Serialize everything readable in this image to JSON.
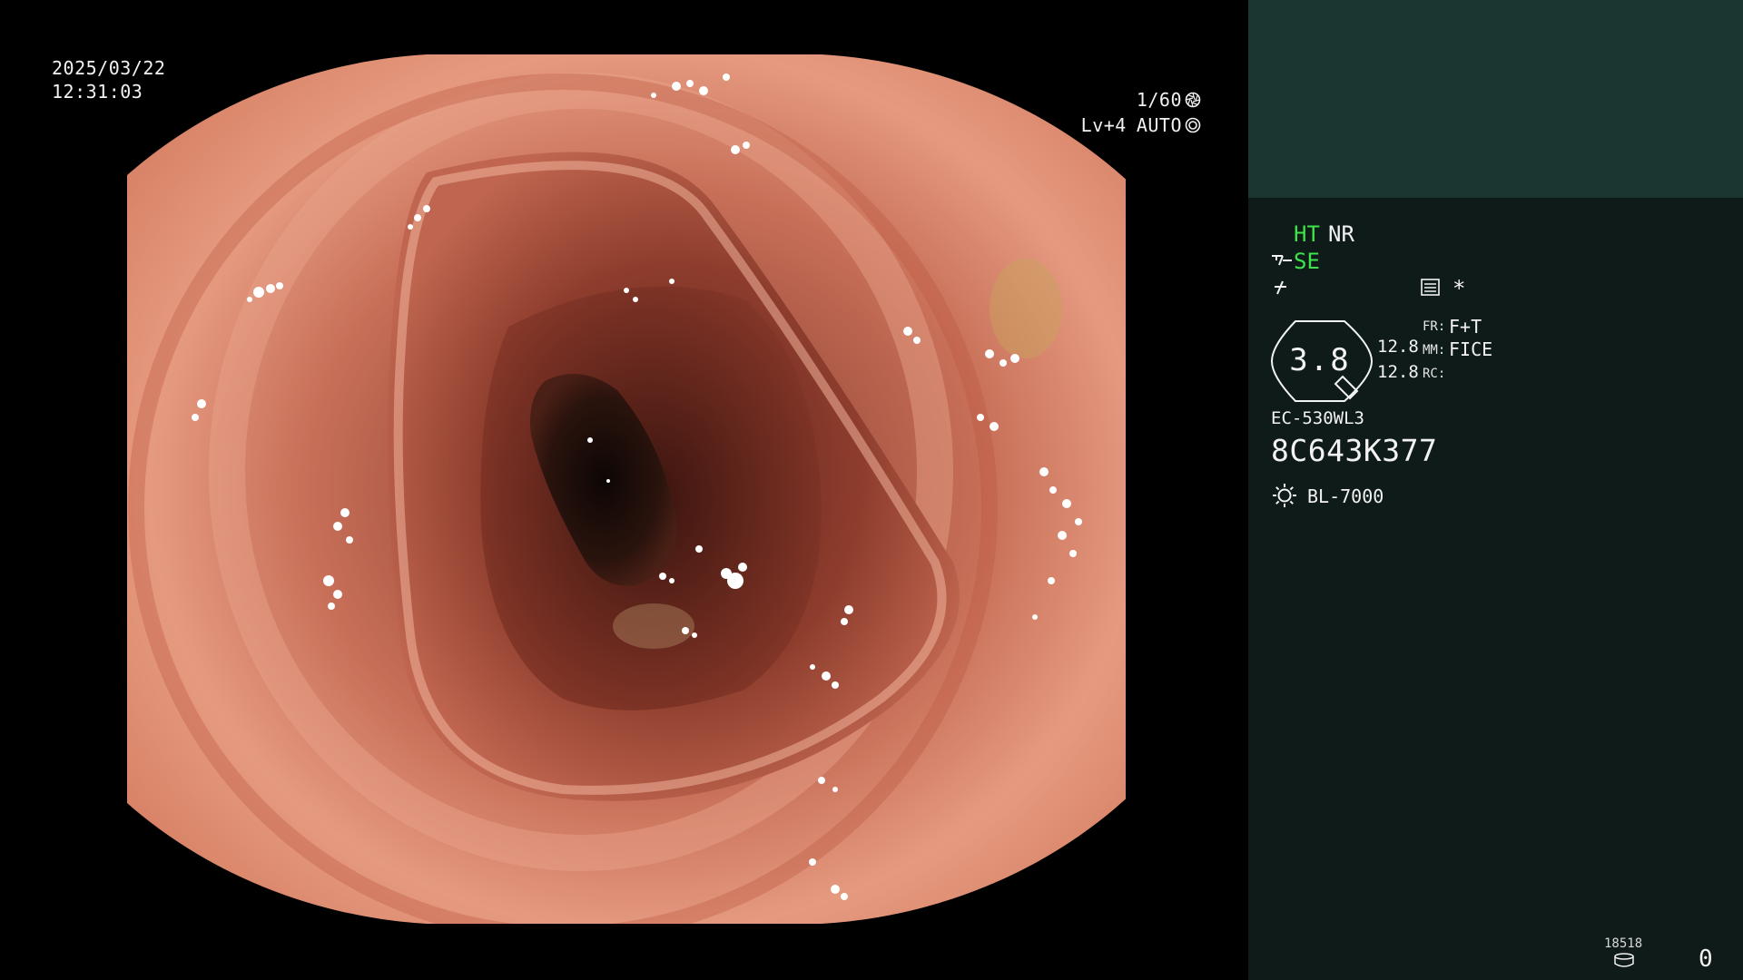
{
  "overlay": {
    "date": "2025/03/22",
    "time": "12:31:03",
    "shutter": "1/60",
    "shutter_icon": "aperture-icon",
    "level": "Lv+4",
    "iris": "AUTO",
    "iris_icon": "iris-icon"
  },
  "panel": {
    "ht_label": "HT",
    "nr_label": "NR",
    "se_label": "SE",
    "asterisk": "*",
    "zoom_value": "3.8",
    "val_a": "12.8",
    "val_b": "12.8",
    "fr_label": "FR:",
    "fr_value": "F+T",
    "mm_label": "MM:",
    "mm_value": "FICE",
    "rc_label": "RC:",
    "scope_model": "EC-530WL3",
    "scope_serial": "8C643K377",
    "light_source": "BL-7000",
    "frame_count": "18518",
    "counter": "0"
  },
  "colors": {
    "panel_bg": "#0e1b18",
    "panel_header": "#1b3530",
    "active_text": "#3fe24a",
    "osd_text": "#f2f2f2"
  }
}
